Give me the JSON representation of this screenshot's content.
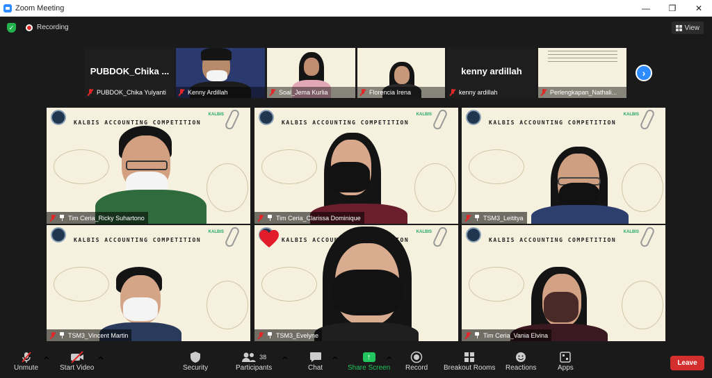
{
  "window": {
    "title": "Zoom Meeting"
  },
  "topbar": {
    "recording_label": "Recording",
    "view_label": "View"
  },
  "strip": [
    {
      "label": "PUBDOK_Chika Yulyanti",
      "big_name": "PUBDOK_Chika ...",
      "video": false
    },
    {
      "label": "Kenny Ardillah",
      "video": true
    },
    {
      "label": "Soal_Jema Kurlia",
      "video": true
    },
    {
      "label": "Florencia Irena",
      "video": true
    },
    {
      "label": "kenny ardillah",
      "big_name": "kenny ardillah",
      "video": false
    },
    {
      "label": "Perlengkapan_Nathali...",
      "video": true
    }
  ],
  "slide_text": "KALBIS ACCOUNTING COMPETITION",
  "slide_brand": "KALBIS",
  "gallery": [
    {
      "label": "Tim Ceria_Ricky Suhartono"
    },
    {
      "label": "Tim Ceria_Clarissa Dominique"
    },
    {
      "label": "TSM3_Leititya"
    },
    {
      "label": "TSM3_Vincent Martin"
    },
    {
      "label": "TSM3_Evelyne"
    },
    {
      "label": "Tim Ceria_Vania Elvina"
    }
  ],
  "toolbar": {
    "unmute": "Unmute",
    "start_video": "Start Video",
    "security": "Security",
    "participants": "Participants",
    "participant_count": "38",
    "chat": "Chat",
    "share_screen": "Share Screen",
    "record": "Record",
    "breakout_rooms": "Breakout Rooms",
    "reactions": "Reactions",
    "apps": "Apps",
    "leave": "Leave"
  },
  "colors": {
    "accent": "#2d8cff",
    "leave": "#d32f2f",
    "share": "#22c55e",
    "muted": "#e02828"
  }
}
